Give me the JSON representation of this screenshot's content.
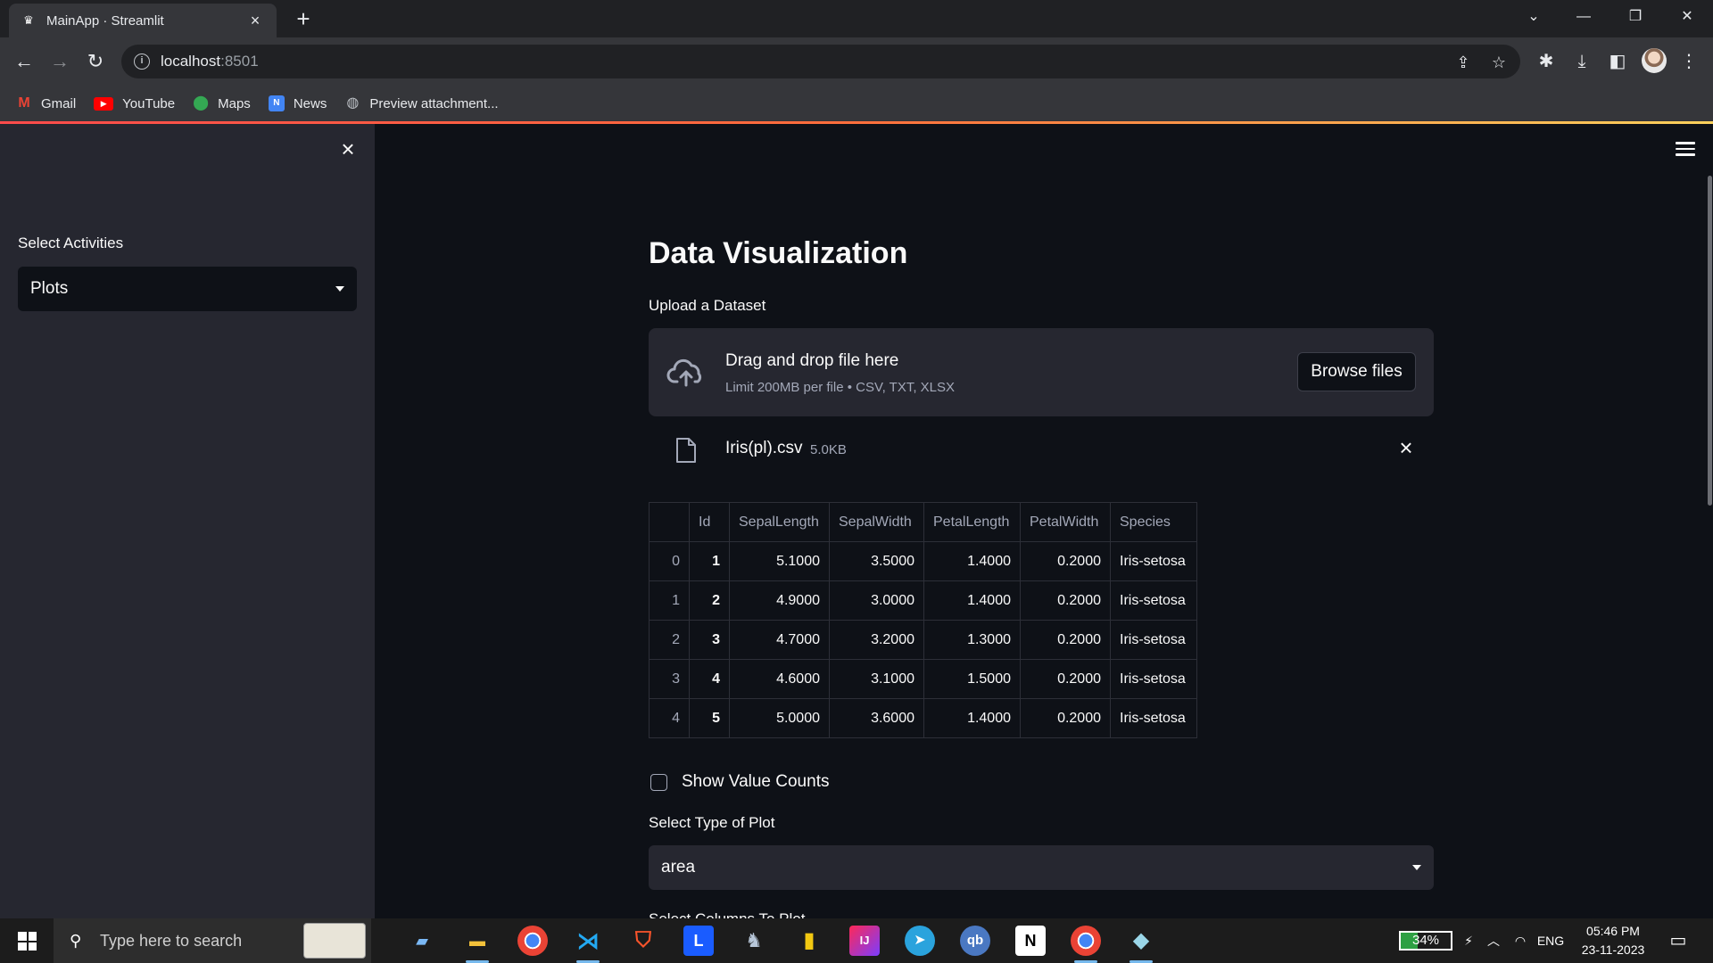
{
  "browser": {
    "tab_title": "MainApp · Streamlit",
    "url_host": "localhost",
    "url_port": ":8501",
    "bookmarks": [
      {
        "label": "Gmail",
        "icon": "gmail-icon"
      },
      {
        "label": "YouTube",
        "icon": "youtube-icon"
      },
      {
        "label": "Maps",
        "icon": "maps-icon"
      },
      {
        "label": "News",
        "icon": "news-icon"
      },
      {
        "label": "Preview attachment...",
        "icon": "globe-icon"
      }
    ]
  },
  "sidebar": {
    "label": "Select Activities",
    "select_value": "Plots"
  },
  "main": {
    "title": "Data Visualization",
    "upload_label": "Upload a Dataset",
    "dropzone": {
      "title": "Drag and drop file here",
      "subtitle": "Limit 200MB per file • CSV, TXT, XLSX",
      "browse_label": "Browse files"
    },
    "file": {
      "name": "Iris(pl).csv",
      "size": "5.0KB"
    },
    "table": {
      "columns": [
        "",
        "Id",
        "SepalLength",
        "SepalWidth",
        "PetalLength",
        "PetalWidth",
        "Species"
      ],
      "rows": [
        [
          "0",
          "1",
          "5.1000",
          "3.5000",
          "1.4000",
          "0.2000",
          "Iris-setosa"
        ],
        [
          "1",
          "2",
          "4.9000",
          "3.0000",
          "1.4000",
          "0.2000",
          "Iris-setosa"
        ],
        [
          "2",
          "3",
          "4.7000",
          "3.2000",
          "1.3000",
          "0.2000",
          "Iris-setosa"
        ],
        [
          "3",
          "4",
          "4.6000",
          "3.1000",
          "1.5000",
          "0.2000",
          "Iris-setosa"
        ],
        [
          "4",
          "5",
          "5.0000",
          "3.6000",
          "1.4000",
          "0.2000",
          "Iris-setosa"
        ]
      ]
    },
    "checkbox_label": "Show Value Counts",
    "plot_type_label": "Select Type of Plot",
    "plot_type_value": "area",
    "columns_label_partial": "Select Columns To Plot"
  },
  "taskbar": {
    "search_placeholder": "Type here to search",
    "apps": [
      "file-explorer-icon",
      "folder-icon",
      "chrome-icon",
      "vscode-icon",
      "brave-icon",
      "l-app-icon",
      "postgres-icon",
      "powerbi-icon",
      "intellij-icon",
      "telegram-icon",
      "qbittorrent-icon",
      "notion-icon",
      "chrome-active-icon",
      "tablet-app-icon"
    ],
    "battery": "34%",
    "language": "ENG",
    "time": "05:46 PM",
    "date": "23-11-2023"
  },
  "colors": {
    "streamlit_bg": "#0e1117",
    "sidebar_bg": "#262730",
    "accent_gradient_start": "#ff4b4b",
    "accent_gradient_end": "#fdd15c"
  }
}
